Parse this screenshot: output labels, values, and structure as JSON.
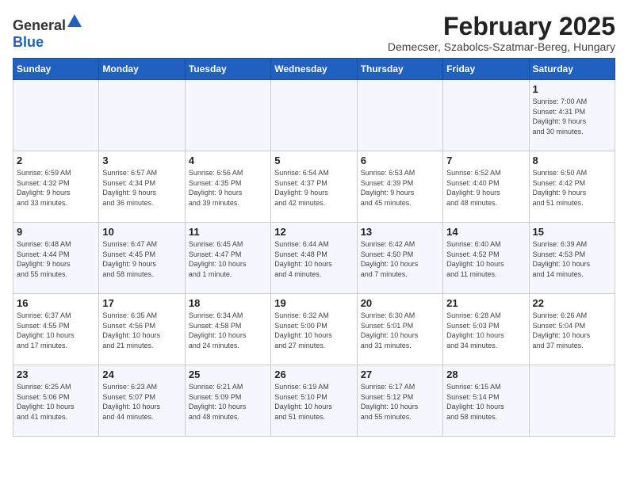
{
  "logo": {
    "general": "General",
    "blue": "Blue"
  },
  "title": "February 2025",
  "subtitle": "Demecser, Szabolcs-Szatmar-Bereg, Hungary",
  "headers": [
    "Sunday",
    "Monday",
    "Tuesday",
    "Wednesday",
    "Thursday",
    "Friday",
    "Saturday"
  ],
  "weeks": [
    [
      {
        "day": "",
        "info": ""
      },
      {
        "day": "",
        "info": ""
      },
      {
        "day": "",
        "info": ""
      },
      {
        "day": "",
        "info": ""
      },
      {
        "day": "",
        "info": ""
      },
      {
        "day": "",
        "info": ""
      },
      {
        "day": "1",
        "info": "Sunrise: 7:00 AM\nSunset: 4:31 PM\nDaylight: 9 hours\nand 30 minutes."
      }
    ],
    [
      {
        "day": "2",
        "info": "Sunrise: 6:59 AM\nSunset: 4:32 PM\nDaylight: 9 hours\nand 33 minutes."
      },
      {
        "day": "3",
        "info": "Sunrise: 6:57 AM\nSunset: 4:34 PM\nDaylight: 9 hours\nand 36 minutes."
      },
      {
        "day": "4",
        "info": "Sunrise: 6:56 AM\nSunset: 4:35 PM\nDaylight: 9 hours\nand 39 minutes."
      },
      {
        "day": "5",
        "info": "Sunrise: 6:54 AM\nSunset: 4:37 PM\nDaylight: 9 hours\nand 42 minutes."
      },
      {
        "day": "6",
        "info": "Sunrise: 6:53 AM\nSunset: 4:39 PM\nDaylight: 9 hours\nand 45 minutes."
      },
      {
        "day": "7",
        "info": "Sunrise: 6:52 AM\nSunset: 4:40 PM\nDaylight: 9 hours\nand 48 minutes."
      },
      {
        "day": "8",
        "info": "Sunrise: 6:50 AM\nSunset: 4:42 PM\nDaylight: 9 hours\nand 51 minutes."
      }
    ],
    [
      {
        "day": "9",
        "info": "Sunrise: 6:48 AM\nSunset: 4:44 PM\nDaylight: 9 hours\nand 55 minutes."
      },
      {
        "day": "10",
        "info": "Sunrise: 6:47 AM\nSunset: 4:45 PM\nDaylight: 9 hours\nand 58 minutes."
      },
      {
        "day": "11",
        "info": "Sunrise: 6:45 AM\nSunset: 4:47 PM\nDaylight: 10 hours\nand 1 minute."
      },
      {
        "day": "12",
        "info": "Sunrise: 6:44 AM\nSunset: 4:48 PM\nDaylight: 10 hours\nand 4 minutes."
      },
      {
        "day": "13",
        "info": "Sunrise: 6:42 AM\nSunset: 4:50 PM\nDaylight: 10 hours\nand 7 minutes."
      },
      {
        "day": "14",
        "info": "Sunrise: 6:40 AM\nSunset: 4:52 PM\nDaylight: 10 hours\nand 11 minutes."
      },
      {
        "day": "15",
        "info": "Sunrise: 6:39 AM\nSunset: 4:53 PM\nDaylight: 10 hours\nand 14 minutes."
      }
    ],
    [
      {
        "day": "16",
        "info": "Sunrise: 6:37 AM\nSunset: 4:55 PM\nDaylight: 10 hours\nand 17 minutes."
      },
      {
        "day": "17",
        "info": "Sunrise: 6:35 AM\nSunset: 4:56 PM\nDaylight: 10 hours\nand 21 minutes."
      },
      {
        "day": "18",
        "info": "Sunrise: 6:34 AM\nSunset: 4:58 PM\nDaylight: 10 hours\nand 24 minutes."
      },
      {
        "day": "19",
        "info": "Sunrise: 6:32 AM\nSunset: 5:00 PM\nDaylight: 10 hours\nand 27 minutes."
      },
      {
        "day": "20",
        "info": "Sunrise: 6:30 AM\nSunset: 5:01 PM\nDaylight: 10 hours\nand 31 minutes."
      },
      {
        "day": "21",
        "info": "Sunrise: 6:28 AM\nSunset: 5:03 PM\nDaylight: 10 hours\nand 34 minutes."
      },
      {
        "day": "22",
        "info": "Sunrise: 6:26 AM\nSunset: 5:04 PM\nDaylight: 10 hours\nand 37 minutes."
      }
    ],
    [
      {
        "day": "23",
        "info": "Sunrise: 6:25 AM\nSunset: 5:06 PM\nDaylight: 10 hours\nand 41 minutes."
      },
      {
        "day": "24",
        "info": "Sunrise: 6:23 AM\nSunset: 5:07 PM\nDaylight: 10 hours\nand 44 minutes."
      },
      {
        "day": "25",
        "info": "Sunrise: 6:21 AM\nSunset: 5:09 PM\nDaylight: 10 hours\nand 48 minutes."
      },
      {
        "day": "26",
        "info": "Sunrise: 6:19 AM\nSunset: 5:10 PM\nDaylight: 10 hours\nand 51 minutes."
      },
      {
        "day": "27",
        "info": "Sunrise: 6:17 AM\nSunset: 5:12 PM\nDaylight: 10 hours\nand 55 minutes."
      },
      {
        "day": "28",
        "info": "Sunrise: 6:15 AM\nSunset: 5:14 PM\nDaylight: 10 hours\nand 58 minutes."
      },
      {
        "day": "",
        "info": ""
      }
    ]
  ]
}
